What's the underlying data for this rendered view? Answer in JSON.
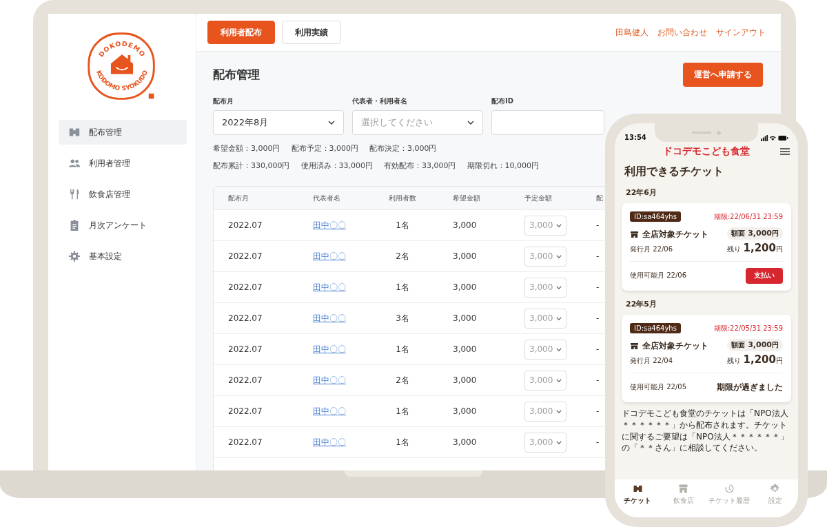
{
  "laptop": {
    "logo": {
      "top": "DOKODEMO",
      "bottom": "KODOMO SYOKUDO"
    },
    "sidebar": {
      "items": [
        {
          "label": "配布管理",
          "selected": true
        },
        {
          "label": "利用者管理",
          "selected": false
        },
        {
          "label": "飲食店管理",
          "selected": false
        },
        {
          "label": "月次アンケート",
          "selected": false
        },
        {
          "label": "基本設定",
          "selected": false
        }
      ]
    },
    "top_tabs": [
      {
        "label": "利用者配布",
        "selected": true
      },
      {
        "label": "利用実績",
        "selected": false
      }
    ],
    "user_links": [
      "田島健人",
      "お問い合わせ",
      "サインアウト"
    ],
    "page_title": "配布管理",
    "apply_button": "運営へ申請する",
    "filters": [
      {
        "label": "配布月",
        "kind": "select",
        "value": "2022年8月"
      },
      {
        "label": "代表者・利用者名",
        "kind": "select",
        "placeholder": "選択してください"
      },
      {
        "label": "配布ID",
        "kind": "input"
      }
    ],
    "summary_lines": [
      [
        "希望金額：3,000円",
        "配布予定：3,000円",
        "配布決定：3,000円"
      ],
      [
        "配布累計：330,000円",
        "使用済み：33,000円",
        "有効配布：33,000円",
        "期限切れ：10,000円"
      ]
    ],
    "table": {
      "columns": [
        "配布月",
        "代表者名",
        "利用者数",
        "希望金額",
        "予定金額",
        "配"
      ],
      "rows": [
        {
          "month": "2022.07",
          "representative": "田中〇〇",
          "users": "1名",
          "requested": "3,000",
          "planned": "3,000",
          "column_6": "-"
        },
        {
          "month": "2022.07",
          "representative": "田中〇〇",
          "users": "2名",
          "requested": "3,000",
          "planned": "3,000",
          "column_6": "-"
        },
        {
          "month": "2022.07",
          "representative": "田中〇〇",
          "users": "1名",
          "requested": "3,000",
          "planned": "3,000",
          "column_6": "-"
        },
        {
          "month": "2022.07",
          "representative": "田中〇〇",
          "users": "3名",
          "requested": "3,000",
          "planned": "3,000",
          "column_6": "-"
        },
        {
          "month": "2022.07",
          "representative": "田中〇〇",
          "users": "1名",
          "requested": "3,000",
          "planned": "3,000",
          "column_6": "-"
        },
        {
          "month": "2022.07",
          "representative": "田中〇〇",
          "users": "2名",
          "requested": "3,000",
          "planned": "3,000",
          "column_6": "-"
        },
        {
          "month": "2022.07",
          "representative": "田中〇〇",
          "users": "1名",
          "requested": "3,000",
          "planned": "3,000",
          "column_6": "-"
        },
        {
          "month": "2022.07",
          "representative": "田中〇〇",
          "users": "1名",
          "requested": "3,000",
          "planned": "3,000",
          "column_6": "-"
        }
      ]
    }
  },
  "phone": {
    "status_time": "13:54",
    "app_title": "ドコデモこども食堂",
    "heading": "利用できるチケット",
    "groups": [
      {
        "month": "22年6月",
        "ticket": {
          "id": "ID:sa464yhs",
          "deadline": "期限:22/06/31 23:59",
          "name": "全店対象チケット",
          "issued": "発行月 22/06",
          "face_label": "額面",
          "face_value": "3,000",
          "face_unit": "円",
          "remaining_label": "残り",
          "remaining_value": "1,200",
          "remaining_unit": "円",
          "usable": "使用可能月 22/06",
          "kind": "pay",
          "action": "支払い"
        }
      },
      {
        "month": "22年5月",
        "ticket": {
          "id": "ID:sa464yhs",
          "deadline": "期限:22/05/31 23:59",
          "name": "全店対象チケット",
          "issued": "発行月 22/04",
          "face_label": "額面",
          "face_value": "3,000",
          "face_unit": "円",
          "remaining_label": "残り",
          "remaining_value": "1,200",
          "remaining_unit": "円",
          "usable": "使用可能月 22/05",
          "kind": "expired",
          "action": "期限が過ぎました"
        }
      }
    ],
    "notice": "ドコデモこども食堂のチケットは「NPO法人＊＊＊＊＊＊」から配布されます。チケットに関するご要望は「NPO法人＊＊＊＊＊＊」の「＊＊さん」に相談してください。",
    "tabs": [
      {
        "label": "チケット",
        "selected": true
      },
      {
        "label": "飲食店",
        "selected": false
      },
      {
        "label": "チケット履歴",
        "selected": false
      },
      {
        "label": "設定",
        "selected": false
      }
    ]
  }
}
